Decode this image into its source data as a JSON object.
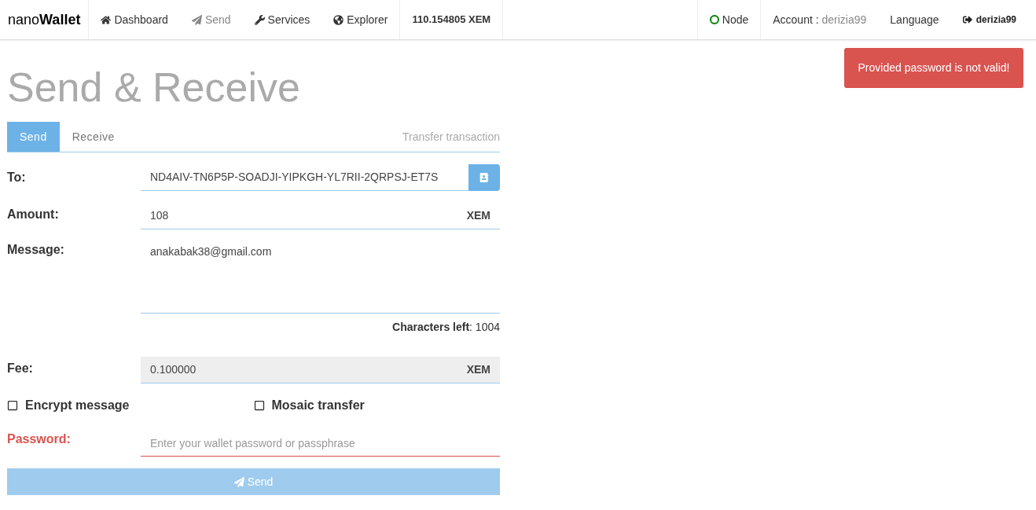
{
  "navbar": {
    "brand": {
      "light": "nano",
      "bold": "Wallet"
    },
    "items": [
      {
        "label": "Dashboard",
        "kind": "home",
        "selected": false
      },
      {
        "label": "Send",
        "kind": "send",
        "selected": true
      },
      {
        "label": "Services",
        "kind": "wrench",
        "selected": false
      },
      {
        "label": "Explorer",
        "kind": "globe",
        "selected": false
      }
    ],
    "balance": "110.154805 XEM",
    "node": {
      "label": "Node",
      "color": "#008000"
    },
    "account": {
      "label": "Account :",
      "value": "derizia99"
    },
    "language": "Language",
    "logout": "derizia99"
  },
  "alert": "Provided password is not valid!",
  "page_title": "Send & Receive",
  "tabs": [
    {
      "label": "Send",
      "selected": true
    },
    {
      "label": "Receive",
      "selected": false
    }
  ],
  "tabs_caption": "Transfer transaction",
  "form": {
    "to": {
      "label": "To:",
      "value": "ND4AIV-TN6P5P-SOADJI-YIPKGH-YL7RII-2QRPSJ-ET7S"
    },
    "amount": {
      "label": "Amount:",
      "value": "108",
      "unit": "XEM"
    },
    "message": {
      "label": "Message:",
      "value": "anakabak38@gmail.com"
    },
    "chars_left": {
      "label": "Characters left",
      "value": ": 1004"
    },
    "fee": {
      "label": "Fee:",
      "value": "0.100000",
      "unit": "XEM"
    },
    "checkboxes": [
      {
        "label": "Encrypt message",
        "checked": false
      },
      {
        "label": "Mosaic transfer",
        "checked": false
      }
    ],
    "password": {
      "label": "Password:",
      "placeholder": "Enter your wallet password or passphrase",
      "error": true
    },
    "submit": {
      "label": "Send",
      "disabled": true
    }
  }
}
